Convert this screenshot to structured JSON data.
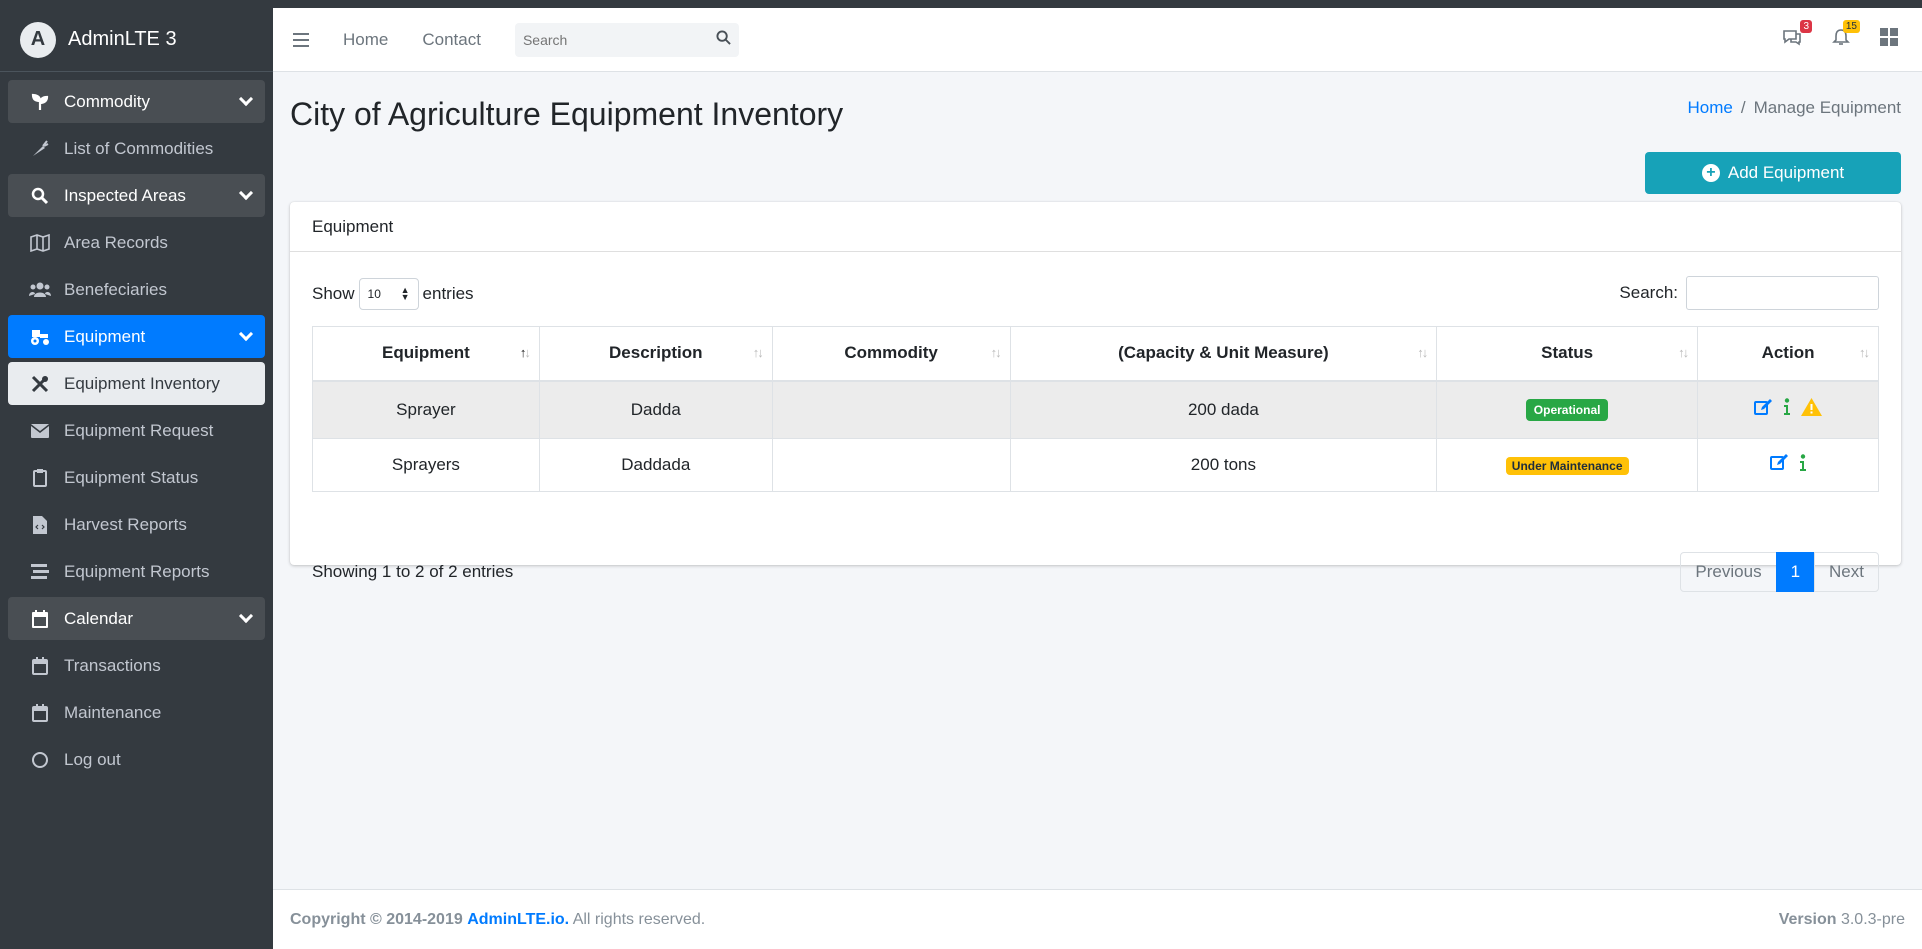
{
  "brand": {
    "name": "AdminLTE 3",
    "logo_letter": "A"
  },
  "sidebar": {
    "items": [
      {
        "label": "Commodity"
      },
      {
        "label": "List of Commodities"
      },
      {
        "label": "Inspected Areas"
      },
      {
        "label": "Area Records"
      },
      {
        "label": "Benefeciaries"
      },
      {
        "label": "Equipment"
      },
      {
        "label": "Equipment Inventory"
      },
      {
        "label": "Equipment Request"
      },
      {
        "label": "Equipment Status"
      },
      {
        "label": "Harvest Reports"
      },
      {
        "label": "Equipment Reports"
      },
      {
        "label": "Calendar"
      },
      {
        "label": "Transactions"
      },
      {
        "label": "Maintenance"
      },
      {
        "label": "Log out"
      }
    ]
  },
  "navbar": {
    "home": "Home",
    "contact": "Contact",
    "search_placeholder": "Search",
    "messages_count": "3",
    "notifications_count": "15"
  },
  "page": {
    "title": "City of Agriculture Equipment Inventory",
    "breadcrumb_home": "Home",
    "breadcrumb_sep": "/",
    "breadcrumb_current": "Manage Equipment",
    "add_button": "Add Equipment"
  },
  "card": {
    "title": "Equipment",
    "show_label": "Show",
    "entries_label": "entries",
    "page_length": "10",
    "search_label": "Search:"
  },
  "table": {
    "headers": [
      "Equipment",
      "Description",
      "Commodity",
      "(Capacity & Unit Measure)",
      "Status",
      "Action"
    ],
    "rows": [
      {
        "equipment": "Sprayer",
        "description": "Dadda",
        "commodity": "",
        "capacity": "200 dada",
        "status": "Operational"
      },
      {
        "equipment": "Sprayers",
        "description": "Daddada",
        "commodity": "",
        "capacity": "200 tons",
        "status": "Under Maintenance"
      }
    ],
    "info": "Showing 1 to 2 of 2 entries",
    "prev": "Previous",
    "page": "1",
    "next": "Next"
  },
  "footer": {
    "copyright": "Copyright © 2014-2019",
    "brand_link": "AdminLTE.io.",
    "rights": "All rights reserved.",
    "version_label": "Version",
    "version": "3.0.3-pre"
  },
  "colors": {
    "sidebar_bg": "#343a40",
    "active": "#007bff",
    "info": "#17a2b8",
    "success": "#28a745",
    "warning": "#ffc107"
  }
}
